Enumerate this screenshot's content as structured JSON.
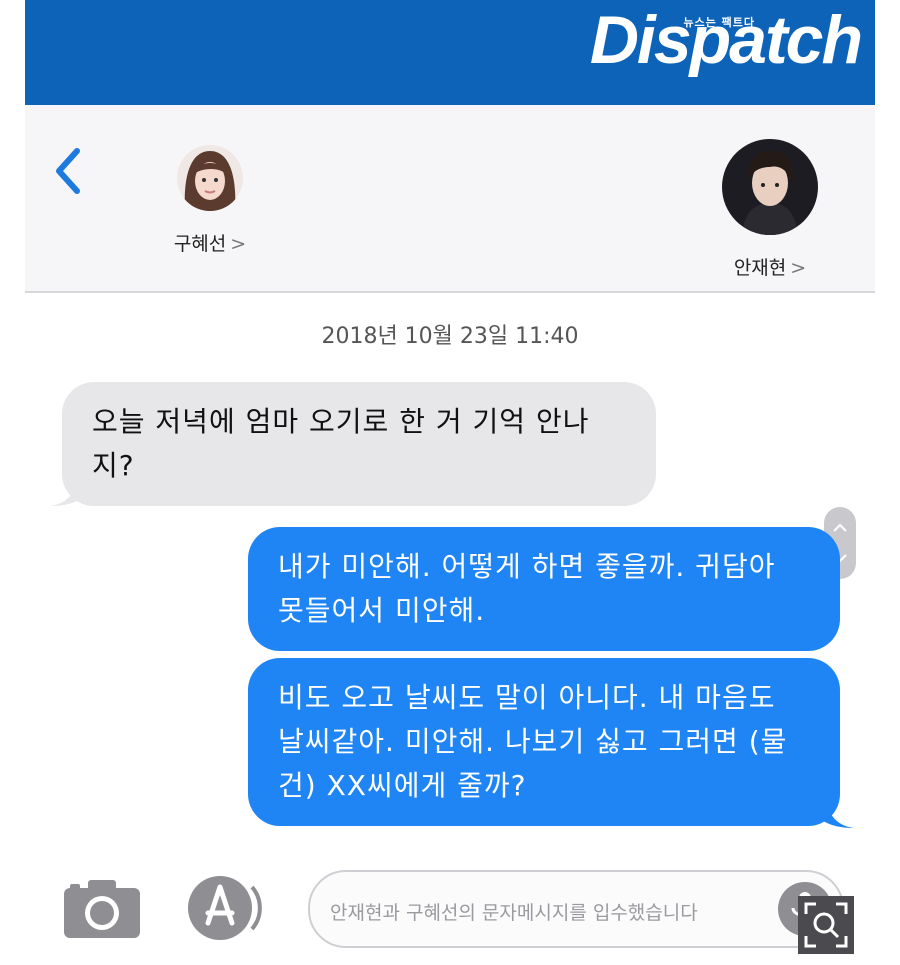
{
  "banner": {
    "logo": "Dispatch",
    "tagline": "뉴스는 팩트다"
  },
  "contacts": {
    "left": {
      "name": "구혜선",
      "chevron": ">"
    },
    "right": {
      "name": "안재현",
      "chevron": ">"
    }
  },
  "thread": {
    "timestamp": "2018년 10월 23일  11:40",
    "messages": [
      {
        "direction": "incoming",
        "text": "오늘 저녁에 엄마 오기로 한 거 기억 안나지?"
      },
      {
        "direction": "outgoing",
        "text": "내가 미안해. 어떻게 하면 좋을까. 귀담아 못들어서 미안해."
      },
      {
        "direction": "outgoing",
        "text": "비도 오고 날씨도 말이 아니다. 내 마음도 날씨같아. 미안해. 나보기 싫고 그러면 (물건) XX씨에게 줄까?"
      }
    ]
  },
  "composer": {
    "placeholder": "안재현과 구혜선의 문자메시지를 입수했습니다",
    "icons": [
      "camera-icon",
      "app-store-icon",
      "microphone-icon",
      "zoom-icon"
    ]
  },
  "colors": {
    "banner": "#0c63b8",
    "outgoing_bubble": "#1f84f4",
    "incoming_bubble": "#e7e7ea",
    "accent": "#1f7ae0"
  }
}
